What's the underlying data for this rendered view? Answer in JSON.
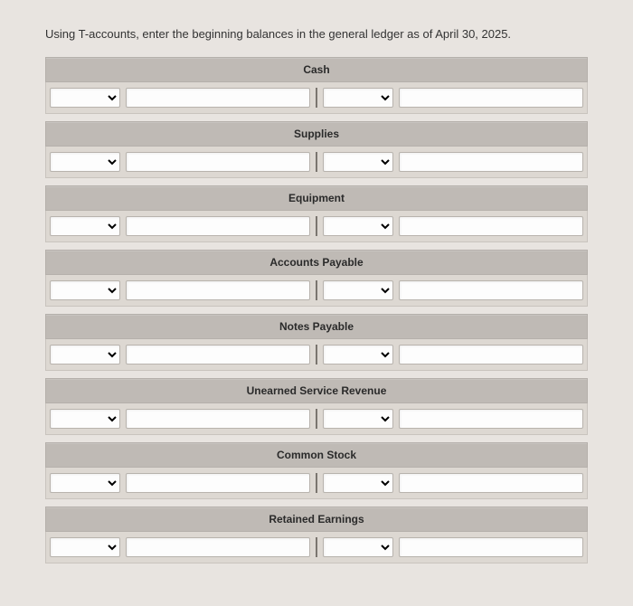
{
  "instruction": "Using T-accounts, enter the beginning balances in the general ledger as of April 30, 2025.",
  "accounts": [
    {
      "title": "Cash"
    },
    {
      "title": "Supplies"
    },
    {
      "title": "Equipment"
    },
    {
      "title": "Accounts Payable"
    },
    {
      "title": "Notes Payable"
    },
    {
      "title": "Unearned Service Revenue"
    },
    {
      "title": "Common Stock"
    },
    {
      "title": "Retained Earnings"
    }
  ],
  "entry": {
    "select_value": "",
    "input_value": ""
  }
}
